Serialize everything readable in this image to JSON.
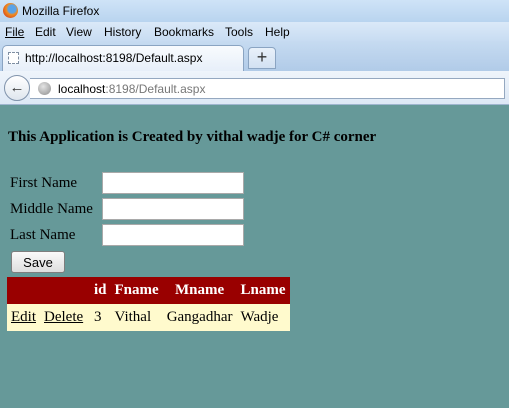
{
  "window": {
    "title": "Mozilla Firefox"
  },
  "menubar": [
    {
      "label": "File"
    },
    {
      "label": "Edit"
    },
    {
      "label": "View"
    },
    {
      "label": "History"
    },
    {
      "label": "Bookmarks"
    },
    {
      "label": "Tools"
    },
    {
      "label": "Help"
    }
  ],
  "tab": {
    "label": "http://localhost:8198/Default.aspx",
    "new_tab_label": "+"
  },
  "address": {
    "host": "localhost",
    "rest": ":8198/Default.aspx"
  },
  "page": {
    "heading": "This Application is Created by vithal wadje for C# corner",
    "form": {
      "first_name_label": "First Name",
      "first_name_value": "",
      "middle_name_label": "Middle Name",
      "middle_name_value": "",
      "last_name_label": "Last Name",
      "last_name_value": "",
      "save_label": "Save"
    },
    "grid": {
      "columns": [
        "",
        "",
        "id",
        "Fname",
        "Mname",
        "Lname"
      ],
      "rows": [
        {
          "edit": "Edit",
          "delete": "Delete",
          "id": "3",
          "fname": "Vithal",
          "mname": "Gangadhar",
          "lname": "Wadje"
        }
      ]
    }
  },
  "colors": {
    "page_background": "#669999",
    "grid_header": "#990000",
    "grid_row": "#fffacd"
  },
  "icons": {
    "browser_logo": "firefox-logo-icon",
    "tab": "page-icon",
    "back": "back-arrow-icon",
    "site": "globe-icon"
  }
}
